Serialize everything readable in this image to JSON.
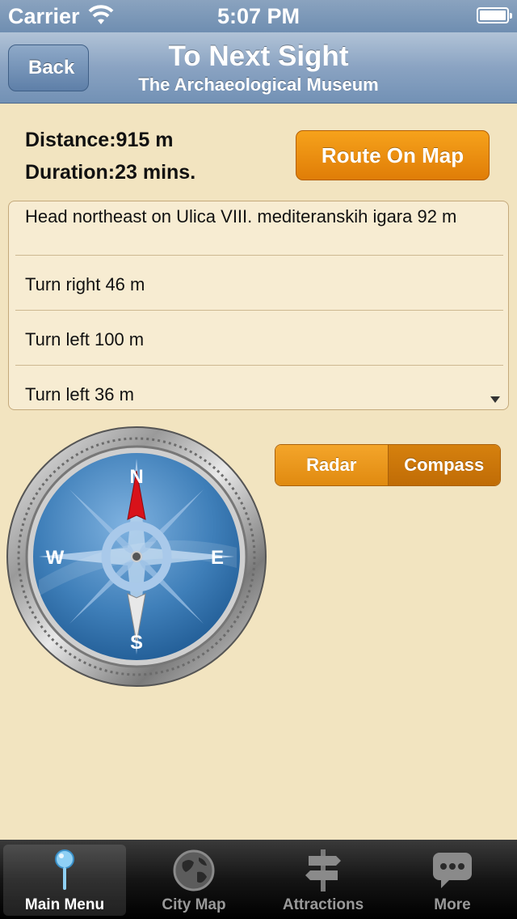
{
  "status_bar": {
    "carrier": "Carrier",
    "time": "5:07 PM"
  },
  "nav": {
    "back_label": "Back",
    "title": "To Next Sight",
    "subtitle": "The Archaeological Museum"
  },
  "info": {
    "distance_label": "Distance:",
    "distance_value": "915 m",
    "duration_label": "Duration:",
    "duration_value": "23 mins.",
    "route_button": "Route On Map"
  },
  "directions": [
    "Head northeast on Ulica VIII. mediteranskih igara 92 m",
    "Turn right 46 m",
    "Turn left 100 m",
    "Turn left 36 m"
  ],
  "mode": {
    "options": [
      "Radar",
      "Compass"
    ],
    "selected": "Compass"
  },
  "compass": {
    "n": "N",
    "e": "E",
    "s": "S",
    "w": "W"
  },
  "tabs": [
    {
      "label": "Main Menu",
      "icon": "pin-icon",
      "active": true
    },
    {
      "label": "City Map",
      "icon": "globe-icon",
      "active": false
    },
    {
      "label": "Attractions",
      "icon": "signpost-icon",
      "active": false
    },
    {
      "label": "More",
      "icon": "chat-bubble-icon",
      "active": false
    }
  ],
  "colors": {
    "nav_blue": "#7291b5",
    "accent_orange": "#f09414",
    "background": "#f2e4c0"
  }
}
